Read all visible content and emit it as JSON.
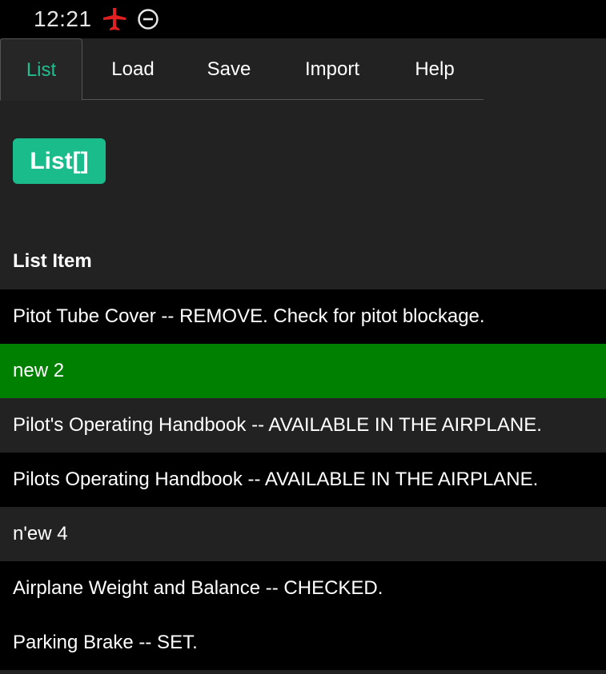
{
  "status_bar": {
    "time": "12:21",
    "icons": [
      "airplane-mode-icon",
      "do-not-disturb-icon"
    ],
    "airplane_color": "#e02020"
  },
  "tabs": [
    {
      "label": "List",
      "active": true
    },
    {
      "label": "Load",
      "active": false
    },
    {
      "label": "Save",
      "active": false
    },
    {
      "label": "Import",
      "active": false
    },
    {
      "label": "Help",
      "active": false
    }
  ],
  "list_button": {
    "label": "List[]"
  },
  "list_header": "List Item",
  "items": [
    {
      "text": "Pitot Tube Cover -- REMOVE. Check for pitot blockage.",
      "state": "normal"
    },
    {
      "text": "new 2",
      "state": "selected"
    },
    {
      "text": "Pilot's Operating Handbook -- AVAILABLE IN THE AIRPLANE.",
      "state": "normal"
    },
    {
      "text": "Pilots Operating Handbook -- AVAILABLE IN THE AIRPLANE.",
      "state": "normal"
    },
    {
      "text": "n'ew 4",
      "state": "normal"
    },
    {
      "text": "Airplane Weight and Balance -- CHECKED.",
      "state": "normal"
    },
    {
      "text": "Parking Brake -- SET.",
      "state": "normal"
    }
  ],
  "colors": {
    "accent": "#1abc8c",
    "selected_row": "#008000"
  }
}
